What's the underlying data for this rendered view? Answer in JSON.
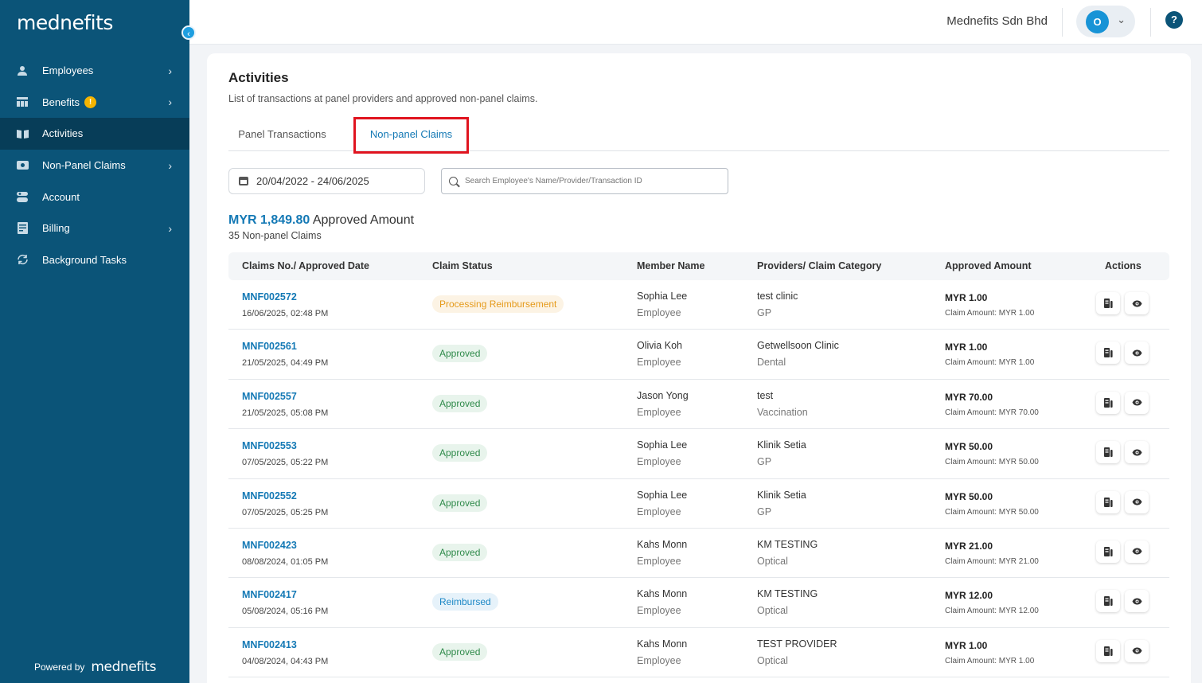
{
  "sidebar": {
    "logo": "mednefits",
    "items": [
      {
        "label": "Employees",
        "icon": "person-icon",
        "chevron": true
      },
      {
        "label": "Benefits",
        "icon": "benefits-icon",
        "chevron": true,
        "alert": "!"
      },
      {
        "label": "Activities",
        "icon": "book-icon",
        "active": true
      },
      {
        "label": "Non-Panel Claims",
        "icon": "cash-icon",
        "chevron": true
      },
      {
        "label": "Account",
        "icon": "account-icon"
      },
      {
        "label": "Billing",
        "icon": "billing-icon",
        "chevron": true
      },
      {
        "label": "Background Tasks",
        "icon": "refresh-icon"
      }
    ],
    "powered_by": "Powered by",
    "powered_brand": "mednefits"
  },
  "topbar": {
    "company": "Mednefits Sdn Bhd",
    "avatar_initial": "O",
    "help": "?"
  },
  "page": {
    "title": "Activities",
    "subtitle": "List of transactions at panel providers and approved non-panel claims.",
    "tabs": [
      "Panel Transactions",
      "Non-panel Claims"
    ],
    "active_tab": "Non-panel Claims",
    "date_range": "20/04/2022 - 24/06/2025",
    "search_placeholder": "Search Employee's Name/Provider/Transaction ID",
    "summary_amount": "MYR 1,849.80",
    "summary_label": "Approved Amount",
    "summary_count": "35 Non-panel Claims"
  },
  "table": {
    "headers": [
      "Claims No./ Approved Date",
      "Claim Status",
      "Member Name",
      "Providers/ Claim Category",
      "Approved Amount",
      "Actions"
    ],
    "rows": [
      {
        "no": "MNF002572",
        "date": "16/06/2025, 02:48 PM",
        "status": "Processing Reimbursement",
        "status_type": "processing",
        "member": "Sophia Lee",
        "role": "Employee",
        "provider": "test clinic",
        "category": "GP",
        "approved": "MYR 1.00",
        "claim": "Claim Amount: MYR 1.00"
      },
      {
        "no": "MNF002561",
        "date": "21/05/2025, 04:49 PM",
        "status": "Approved",
        "status_type": "approved",
        "member": "Olivia Koh",
        "role": "Employee",
        "provider": "Getwellsoon Clinic",
        "category": "Dental",
        "approved": "MYR 1.00",
        "claim": "Claim Amount: MYR 1.00"
      },
      {
        "no": "MNF002557",
        "date": "21/05/2025, 05:08 PM",
        "status": "Approved",
        "status_type": "approved",
        "member": "Jason Yong",
        "role": "Employee",
        "provider": "test",
        "category": "Vaccination",
        "approved": "MYR 70.00",
        "claim": "Claim Amount: MYR 70.00"
      },
      {
        "no": "MNF002553",
        "date": "07/05/2025, 05:22 PM",
        "status": "Approved",
        "status_type": "approved",
        "member": "Sophia Lee",
        "role": "Employee",
        "provider": "Klinik Setia",
        "category": "GP",
        "approved": "MYR 50.00",
        "claim": "Claim Amount: MYR 50.00"
      },
      {
        "no": "MNF002552",
        "date": "07/05/2025, 05:25 PM",
        "status": "Approved",
        "status_type": "approved",
        "member": "Sophia Lee",
        "role": "Employee",
        "provider": "Klinik Setia",
        "category": "GP",
        "approved": "MYR 50.00",
        "claim": "Claim Amount: MYR 50.00"
      },
      {
        "no": "MNF002423",
        "date": "08/08/2024, 01:05 PM",
        "status": "Approved",
        "status_type": "approved",
        "member": "Kahs Monn",
        "role": "Employee",
        "provider": "KM TESTING",
        "category": "Optical",
        "approved": "MYR 21.00",
        "claim": "Claim Amount: MYR 21.00"
      },
      {
        "no": "MNF002417",
        "date": "05/08/2024, 05:16 PM",
        "status": "Reimbursed",
        "status_type": "reimbursed",
        "member": "Kahs Monn",
        "role": "Employee",
        "provider": "KM TESTING",
        "category": "Optical",
        "approved": "MYR 12.00",
        "claim": "Claim Amount: MYR 12.00"
      },
      {
        "no": "MNF002413",
        "date": "04/08/2024, 04:43 PM",
        "status": "Approved",
        "status_type": "approved",
        "member": "Kahs Monn",
        "role": "Employee",
        "provider": "TEST PROVIDER",
        "category": "Optical",
        "approved": "MYR 1.00",
        "claim": "Claim Amount: MYR 1.00"
      }
    ]
  },
  "colors": {
    "sidebar": "#0b5478",
    "accent": "#1479b5",
    "highlight_box": "#e0141f"
  }
}
